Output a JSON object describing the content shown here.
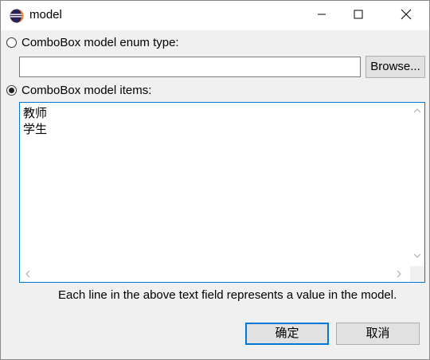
{
  "window": {
    "title": "model",
    "icon": "eclipse-icon",
    "controls": [
      "minimize-icon",
      "maximize-icon",
      "close-icon"
    ]
  },
  "enum_option": {
    "label": "ComboBox model enum type:",
    "selected": false,
    "input_value": "",
    "browse_label": "Browse..."
  },
  "items_option": {
    "label": "ComboBox model items:",
    "selected": true,
    "lines": [
      "教师",
      "学生"
    ]
  },
  "hint": "Each line in the above text field represents a value in the model.",
  "buttons": {
    "ok_label": "确定",
    "cancel_label": "取消"
  },
  "colors": {
    "focus_border": "#0078d7",
    "button_face": "#e1e1e1",
    "dialog_bg": "#f0f0f0"
  }
}
